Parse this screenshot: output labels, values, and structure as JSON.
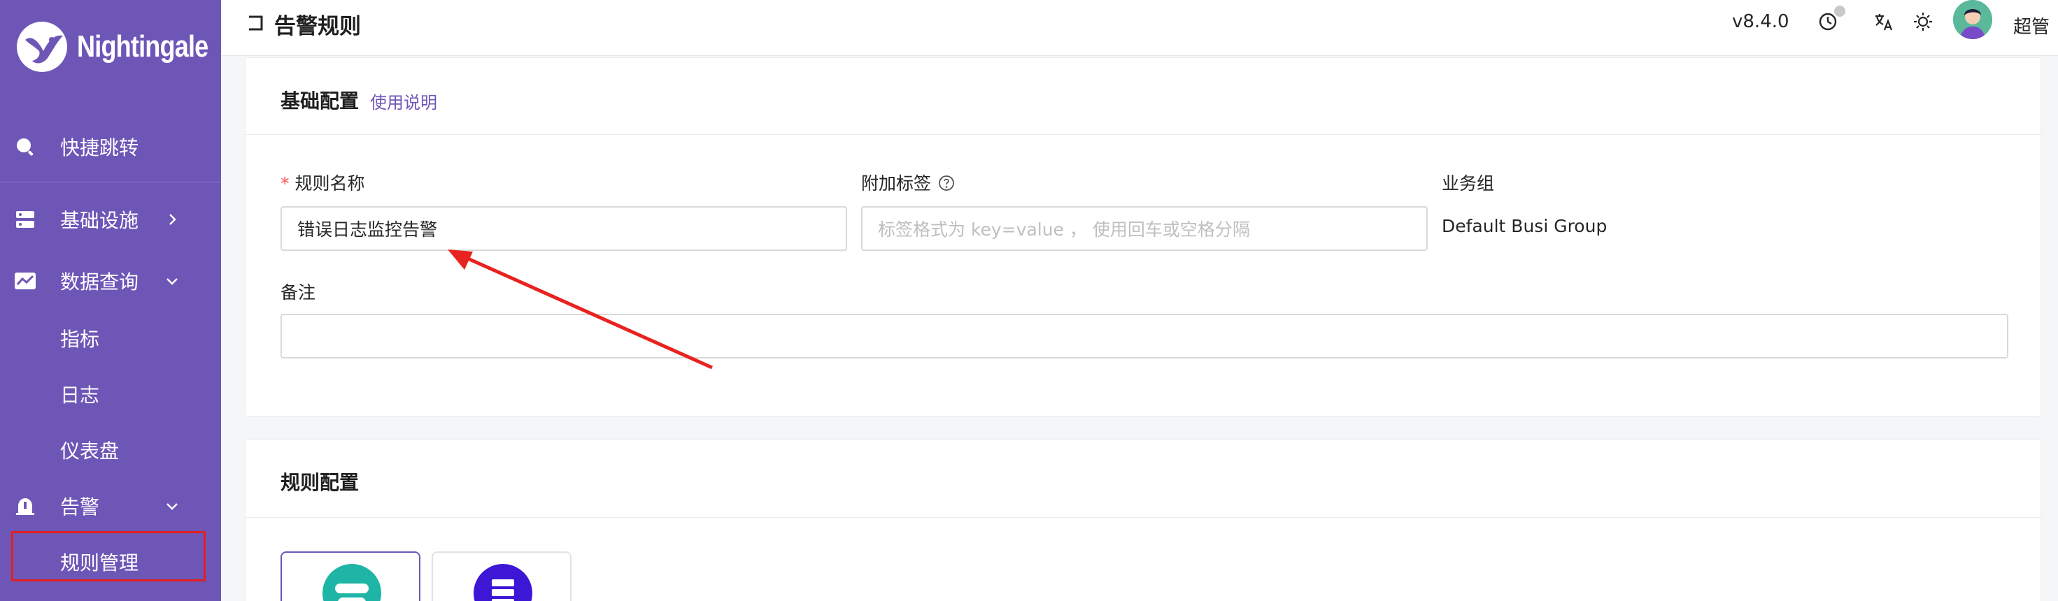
{
  "app": {
    "name": "Nightingale"
  },
  "sidebar": {
    "items": [
      {
        "label": "快捷跳转",
        "icon": "search-icon"
      },
      {
        "label": "基础设施",
        "icon": "server-icon"
      },
      {
        "label": "数据查询",
        "icon": "chart-icon"
      },
      {
        "label": "告警",
        "icon": "alarm-bell-icon"
      }
    ],
    "query_sub": [
      "指标",
      "日志",
      "仪表盘"
    ],
    "alert_sub": [
      "规则管理"
    ]
  },
  "header": {
    "title": "告警规则",
    "version": "v8.4.0",
    "user": "超管"
  },
  "basic": {
    "title": "基础配置",
    "usage_link": "使用说明",
    "rule_name_label": "规则名称",
    "rule_name_value": "错误日志监控告警",
    "tags_label": "附加标签",
    "tags_placeholder": "标签格式为 key=value ， 使用回车或空格分隔",
    "group_label": "业务组",
    "group_value": "Default Busi Group",
    "note_label": "备注",
    "note_value": ""
  },
  "rule": {
    "title": "规则配置"
  },
  "colors": {
    "sidebar": "#6e56b7",
    "accent": "#6e56b7",
    "annotation": "#e02020"
  }
}
